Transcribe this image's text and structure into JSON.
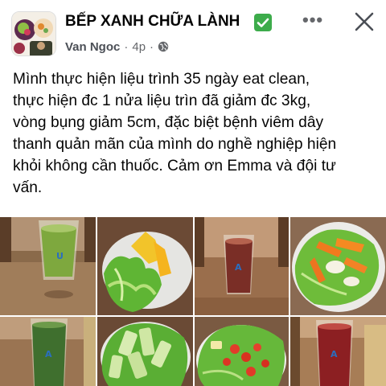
{
  "post": {
    "group_name": "BẾP XANH CHỮA LÀNH",
    "author": "Van Ngoc",
    "time": "4p",
    "separator": "·",
    "icons": {
      "verified": "check-badge-icon",
      "audience": "globe-icon",
      "more": "more-options-icon",
      "close": "close-icon"
    },
    "text_lines": [
      "Mình thực hiện liệu trình 35 ngày eat clean,",
      "thực hiện đc 1 nửa liệu trìn đã giảm đc 3kg,",
      "vòng bụng giảm 5cm, đặc biệt bệnh viêm dây",
      "thanh quản mãn của mình do nghề nghiệp hiện",
      "khỏi không cần thuốc. Cảm ơn Emma và đội tư",
      "vấn."
    ]
  },
  "colors": {
    "verified_green": "#3dac4b",
    "secondary_text": "#65676b"
  },
  "photos": [
    {
      "subject": "green juice glass"
    },
    {
      "subject": "lettuce and yellow pepper plate"
    },
    {
      "subject": "red juice glass"
    },
    {
      "subject": "salad with carrot"
    },
    {
      "subject": "green juice glass"
    },
    {
      "subject": "cucumber salad"
    },
    {
      "subject": "salad with cherry tomatoes"
    },
    {
      "subject": "red juice glass"
    }
  ]
}
